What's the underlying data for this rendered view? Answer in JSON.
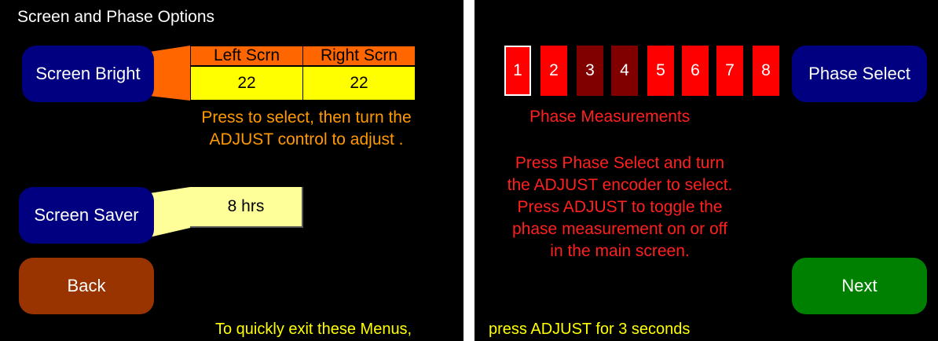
{
  "left": {
    "title": "Screen and Phase Options",
    "screen_bright_label": "Screen Bright",
    "brightness_table": {
      "headers": [
        "Left Scrn",
        "Right Scrn"
      ],
      "values": [
        "22",
        "22"
      ]
    },
    "bright_hint": "Press to select, then turn the ADJUST control to adjust .",
    "screen_saver_label": "Screen Saver",
    "screen_saver_value": "8 hrs",
    "back_label": "Back",
    "footer": "To quickly exit these Menus,"
  },
  "right": {
    "phases": [
      "1",
      "2",
      "3",
      "4",
      "5",
      "6",
      "7",
      "8"
    ],
    "phase_colors": [
      "#ff0000",
      "#ff0000",
      "#800000",
      "#800000",
      "#ff0000",
      "#ff0000",
      "#ff0000",
      "#ff0000"
    ],
    "selected_phase": "1",
    "phase_select_label": "Phase Select",
    "phase_measurements_label": "Phase Measurements",
    "phase_hint": "Press Phase Select and turn the ADJUST encoder to select. Press ADJUST to toggle the phase measurement on or off in the main screen.",
    "next_label": "Next",
    "footer": "press ADJUST for 3 seconds"
  },
  "colors": {
    "navy_button": "#000080",
    "back_button": "#993300",
    "next_button": "#008000",
    "header_orange": "#ff6600",
    "value_yellow": "#ffff00",
    "saver_yellow": "#ffff99"
  }
}
